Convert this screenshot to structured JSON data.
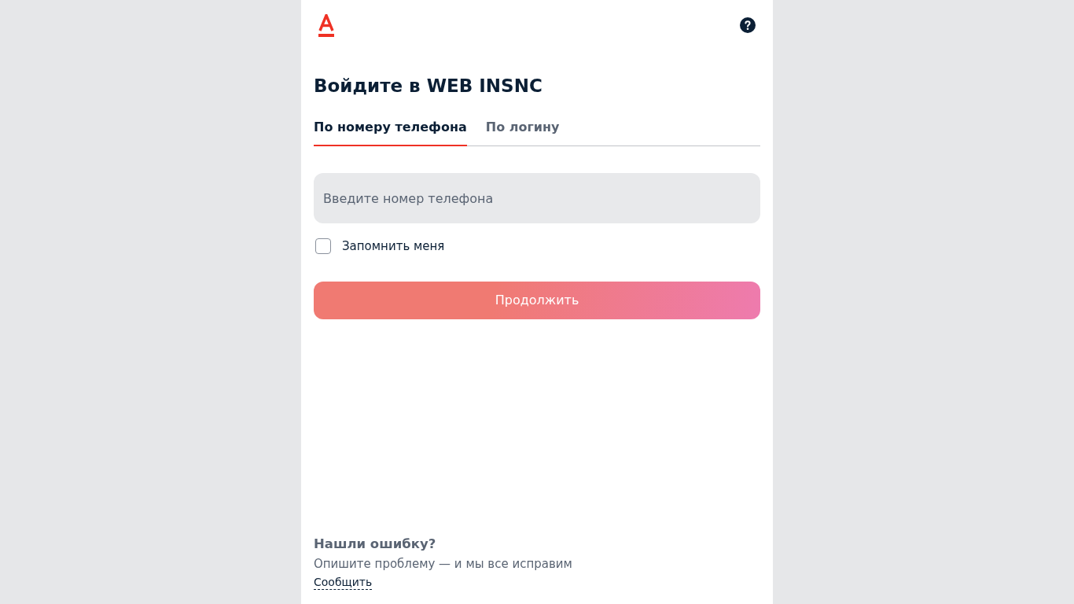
{
  "title": "Войдите в WEB INSNC",
  "tabs": [
    {
      "label": "По номеру телефона",
      "selected": true
    },
    {
      "label": "По логину",
      "selected": false
    }
  ],
  "phone_field": {
    "placeholder": "Введите номер телефона"
  },
  "remember": {
    "label": "Запомнить меня",
    "checked": false
  },
  "continue_button": {
    "label": "Продолжить",
    "disabled": true
  },
  "feedback": {
    "title": "Нашли ошибку?",
    "text": "Опишите проблему — и мы все исправим",
    "link": "Сообщить"
  }
}
